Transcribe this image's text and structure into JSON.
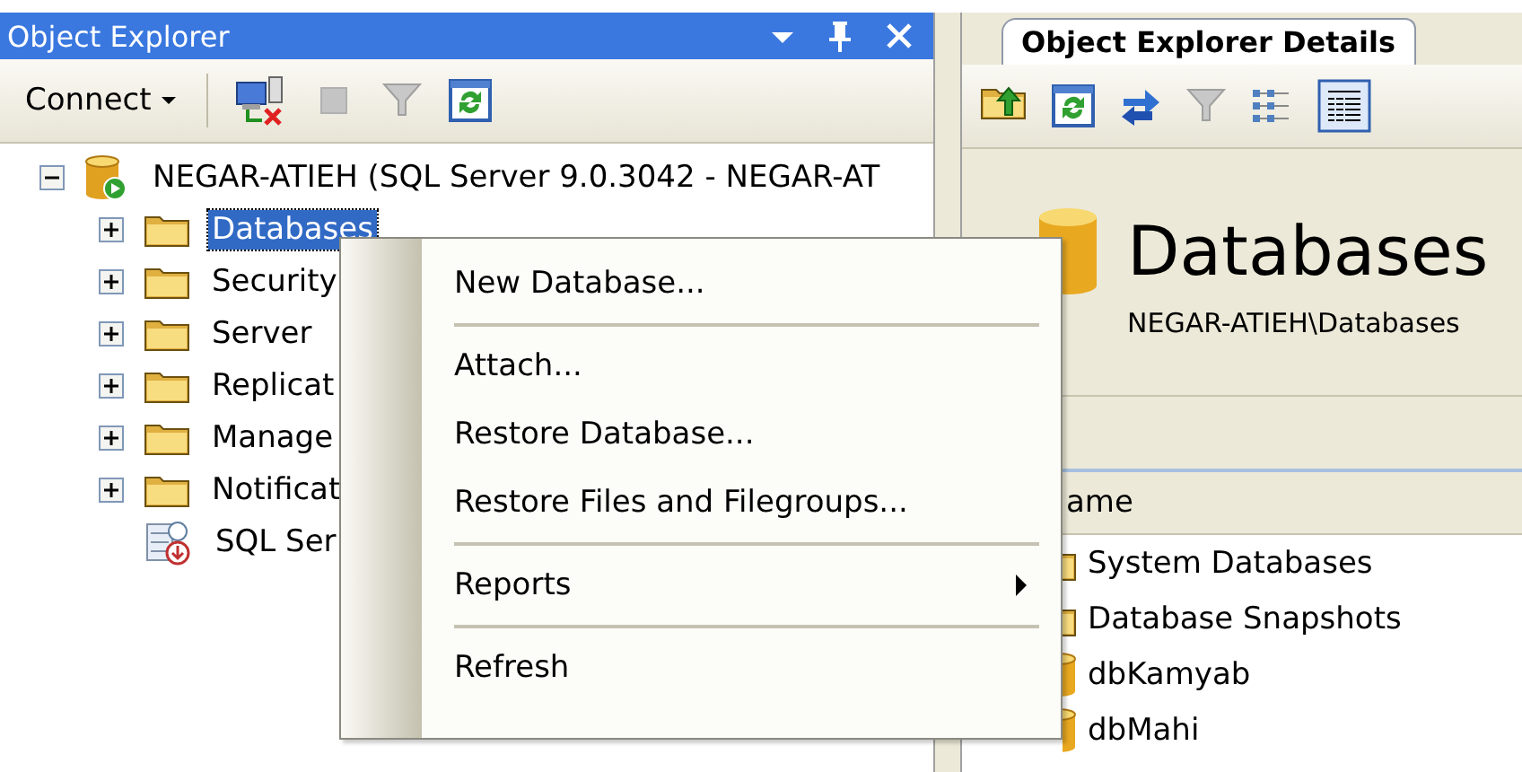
{
  "left_pane": {
    "title": "Object Explorer",
    "toolbar": {
      "connect": "Connect"
    },
    "tree": [
      {
        "label": "NEGAR-ATIEH (SQL Server 9.0.3042 - NEGAR-AT",
        "kind": "server",
        "expanded": true,
        "selected": false,
        "children": [
          {
            "label": "Databases",
            "kind": "folder",
            "expanded": false,
            "selected": true
          },
          {
            "label": "Security",
            "kind": "folder",
            "expanded": false,
            "selected": false
          },
          {
            "label": "Server",
            "kind": "folder",
            "expanded": false,
            "selected": false
          },
          {
            "label": "Replicat",
            "kind": "folder",
            "expanded": false,
            "selected": false
          },
          {
            "label": "Manage",
            "kind": "folder",
            "expanded": false,
            "selected": false
          },
          {
            "label": "Notificat",
            "kind": "folder",
            "expanded": false,
            "selected": false
          },
          {
            "label": "SQL Ser",
            "kind": "agent",
            "selected": false
          }
        ]
      }
    ]
  },
  "right_pane": {
    "tabs": [
      {
        "label": "Object Explorer Details",
        "selected": true
      }
    ],
    "heading": "Databases",
    "path": "NEGAR-ATIEH\\Databases",
    "column": "ame",
    "rows": [
      {
        "label": "System Databases",
        "kind": "folder"
      },
      {
        "label": "Database Snapshots",
        "kind": "folder"
      },
      {
        "label": "dbKamyab",
        "kind": "database"
      },
      {
        "label": "dbMahi",
        "kind": "database"
      }
    ]
  },
  "context_menu": {
    "items": [
      {
        "kind": "item",
        "label": "New Database...",
        "submenu": false
      },
      {
        "kind": "separator"
      },
      {
        "kind": "item",
        "label": "Attach...",
        "submenu": false
      },
      {
        "kind": "item",
        "label": "Restore Database...",
        "submenu": false
      },
      {
        "kind": "item",
        "label": "Restore Files and Filegroups...",
        "submenu": false
      },
      {
        "kind": "separator"
      },
      {
        "kind": "item",
        "label": "Reports",
        "submenu": true
      },
      {
        "kind": "separator"
      },
      {
        "kind": "item",
        "label": "Refresh",
        "submenu": false
      }
    ]
  }
}
